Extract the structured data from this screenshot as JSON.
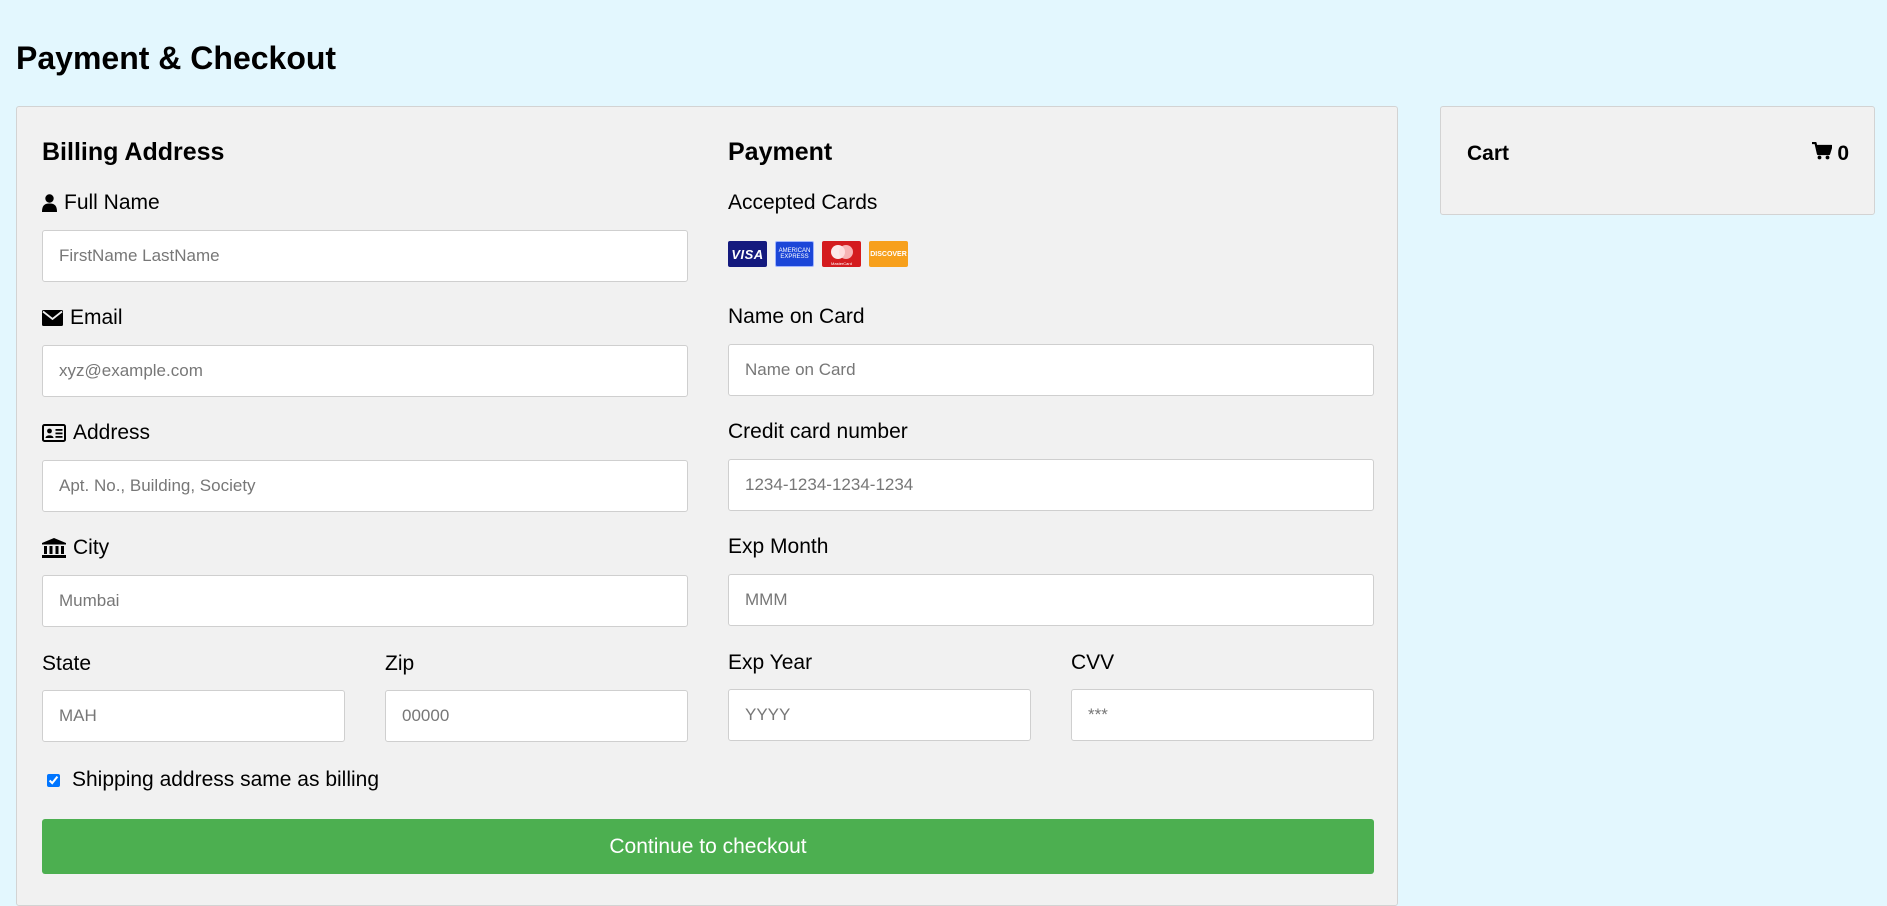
{
  "page_title": "Payment & Checkout",
  "billing": {
    "title": "Billing Address",
    "full_name": {
      "label": "Full Name",
      "placeholder": "FirstName LastName",
      "icon": "user-icon"
    },
    "email": {
      "label": "Email",
      "placeholder": "xyz@example.com",
      "icon": "envelope-icon"
    },
    "address": {
      "label": "Address",
      "placeholder": "Apt. No., Building, Society",
      "icon": "address-card-icon"
    },
    "city": {
      "label": "City",
      "placeholder": "Mumbai",
      "icon": "institution-icon"
    },
    "state": {
      "label": "State",
      "placeholder": "MAH"
    },
    "zip": {
      "label": "Zip",
      "placeholder": "00000"
    },
    "same_as_billing": {
      "label": "Shipping address same as billing",
      "checked": true
    }
  },
  "payment": {
    "title": "Payment",
    "accepted_cards_label": "Accepted Cards",
    "cards": [
      {
        "name": "visa-logo",
        "text": "VISA",
        "color": "#141a7e"
      },
      {
        "name": "amex-logo",
        "text": "AMERICAN EXPRESS",
        "color": "#1b46d8"
      },
      {
        "name": "mastercard-logo",
        "text": "MasterCard",
        "color": "#d41b1e"
      },
      {
        "name": "discover-logo",
        "text": "DISCOVER",
        "color": "#f7a01c"
      }
    ],
    "name_on_card": {
      "label": "Name on Card",
      "placeholder": "Name on Card"
    },
    "card_number": {
      "label": "Credit card number",
      "placeholder": "1234-1234-1234-1234"
    },
    "exp_month": {
      "label": "Exp Month",
      "placeholder": "MMM"
    },
    "exp_year": {
      "label": "Exp Year",
      "placeholder": "YYYY"
    },
    "cvv": {
      "label": "CVV",
      "placeholder": "***"
    }
  },
  "checkout_button": "Continue to checkout",
  "cart": {
    "title": "Cart",
    "count": "0",
    "icon": "shopping-cart-icon"
  },
  "colors": {
    "background": "#e3f7fe",
    "card": "#f1f1f1",
    "accent": "#4caf50"
  }
}
